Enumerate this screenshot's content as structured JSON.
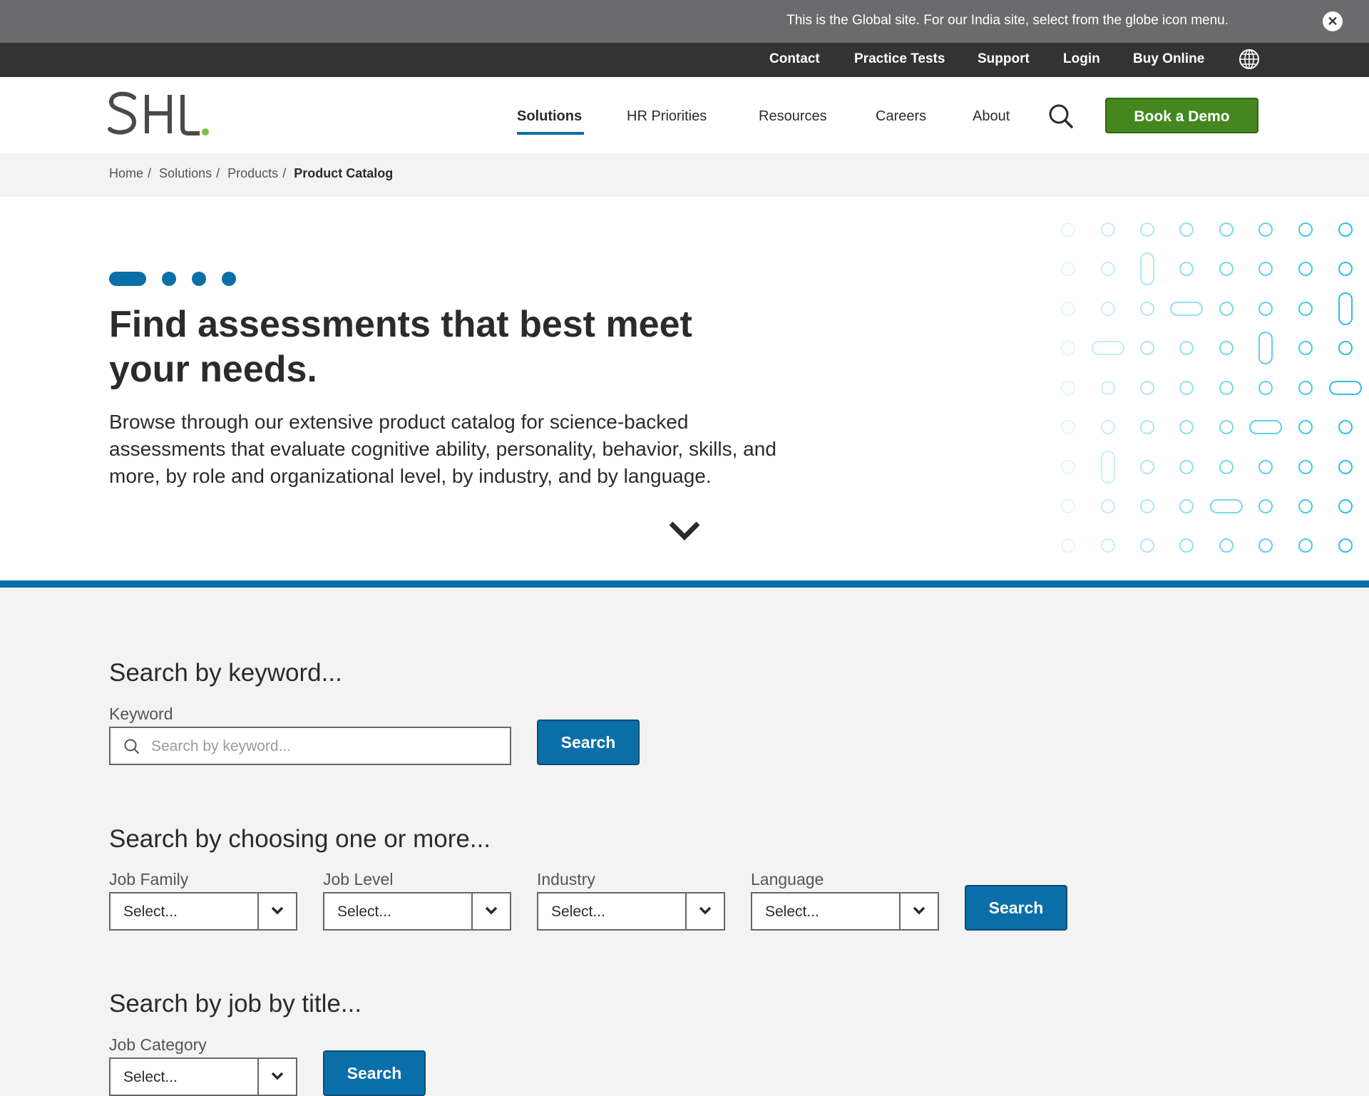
{
  "notice": {
    "text": "This is the Global site. For our India site, select from the globe icon menu.",
    "close": "✕"
  },
  "utility": {
    "links": [
      "Contact",
      "Practice Tests",
      "Support",
      "Login",
      "Buy Online"
    ]
  },
  "header": {
    "logo_text": "SHL",
    "nav": [
      "Solutions",
      "HR Priorities",
      "Resources",
      "Careers",
      "About"
    ],
    "active_nav": "Solutions",
    "demo_button": "Book a Demo"
  },
  "breadcrumb": [
    "Home",
    "Solutions",
    "Products",
    "Product Catalog"
  ],
  "hero": {
    "title": "Find assessments that best meet your needs.",
    "body": "Browse through our extensive product catalog for science-backed assessments that evaluate cognitive ability, personality, behavior, skills, and more, by role and organizational level, by industry, and by language."
  },
  "keyword_section": {
    "title": "Search by keyword...",
    "label": "Keyword",
    "placeholder": "Search by keyword...",
    "button": "Search"
  },
  "filter_section": {
    "title": "Search by choosing one or more...",
    "filters": [
      {
        "label": "Job Family",
        "value": "Select..."
      },
      {
        "label": "Job Level",
        "value": "Select..."
      },
      {
        "label": "Industry",
        "value": "Select..."
      },
      {
        "label": "Language",
        "value": "Select..."
      }
    ],
    "button": "Search"
  },
  "job_section": {
    "title": "Search by job by title...",
    "label": "Job Category",
    "value": "Select...",
    "button": "Search"
  },
  "colors": {
    "brand_blue": "#0a6fa8",
    "demo_green": "#45871f",
    "logo_dot": "#7ac143",
    "dot_pattern": "#2ec1e6"
  }
}
